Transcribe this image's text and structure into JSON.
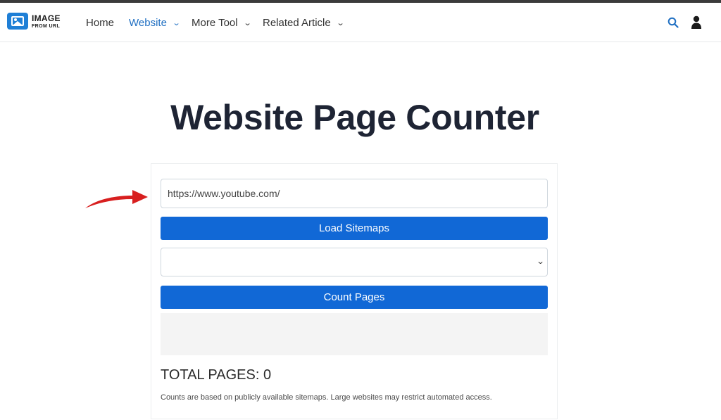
{
  "header": {
    "logo_line1": "IMAGE",
    "logo_line2": "FROM URL",
    "nav": [
      {
        "label": "Home",
        "has_dropdown": false,
        "active": false
      },
      {
        "label": "Website",
        "has_dropdown": true,
        "active": true
      },
      {
        "label": "More Tool",
        "has_dropdown": true,
        "active": false
      },
      {
        "label": "Related Article",
        "has_dropdown": true,
        "active": false
      }
    ],
    "icons": [
      "search-icon",
      "user-icon"
    ],
    "chevron_glyph": "⌄"
  },
  "main": {
    "title": "Website Page Counter",
    "url_input_value": "https://www.youtube.com/",
    "load_button_label": "Load Sitemaps",
    "sitemap_select_value": "",
    "count_button_label": "Count Pages",
    "total_label": "TOTAL PAGES: 0",
    "note": "Counts are based on publicly available sitemaps. Large websites may restrict automated access."
  },
  "colors": {
    "accent": "#1168d6",
    "nav_active": "#1f6fc2",
    "annotation_arrow": "#d81f1f"
  }
}
